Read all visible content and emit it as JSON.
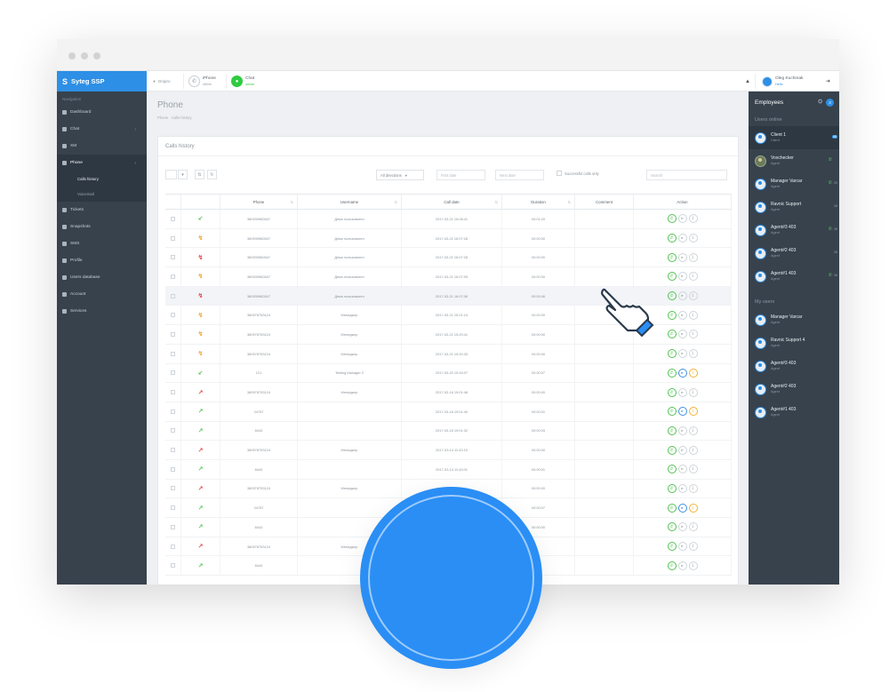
{
  "app": {
    "brand_icon": "S",
    "brand_name": "Syteg SSP"
  },
  "sidebar": {
    "section_label": "Navigation",
    "items": [
      {
        "label": "Dashboard",
        "icon": "dashboard-icon",
        "expandable": false,
        "active": false
      },
      {
        "label": "Chat",
        "icon": "chat-icon",
        "expandable": true,
        "active": false
      },
      {
        "label": "XM",
        "icon": "xm-icon",
        "expandable": false,
        "active": false
      },
      {
        "label": "Phone",
        "icon": "phone-icon",
        "expandable": true,
        "active": true
      },
      {
        "label": "Tickets",
        "icon": "ticket-icon",
        "expandable": false,
        "active": false
      },
      {
        "label": "Snapshots",
        "icon": "snapshot-icon",
        "expandable": false,
        "active": false
      },
      {
        "label": "SMS",
        "icon": "sms-icon",
        "expandable": false,
        "active": false
      },
      {
        "label": "Profile",
        "icon": "profile-icon",
        "expandable": false,
        "active": false
      },
      {
        "label": "Users database",
        "icon": "database-icon",
        "expandable": false,
        "active": false
      },
      {
        "label": "Account",
        "icon": "account-icon",
        "expandable": false,
        "active": false
      },
      {
        "label": "Services",
        "icon": "services-icon",
        "expandable": false,
        "active": false
      }
    ],
    "phone_subitems": [
      {
        "label": "Calls history",
        "active": true
      },
      {
        "label": "Voicemail",
        "active": false
      }
    ]
  },
  "topbar": {
    "location_label": "Dnipro",
    "phone_label": "iPhone",
    "phone_status": "offline",
    "chat_label": "Chat",
    "chat_status": "online",
    "user_name": "Oleg Kuchmak",
    "user_status": "Hello",
    "bell_icon": "bell-icon",
    "logout_icon": "logout-icon"
  },
  "page": {
    "title": "Phone",
    "breadcrumb": "Phone · Calls history",
    "card_title": "Calls history"
  },
  "toolbar": {
    "direction_select": "All directions",
    "first_date_placeholder": "First date",
    "last_date_placeholder": "Next date",
    "successful_only_label": "Successful calls only",
    "search_placeholder": "Search"
  },
  "table": {
    "columns": [
      "",
      "",
      "Phone",
      "Username",
      "Call date",
      "Duration",
      "Comment",
      "Action"
    ],
    "rows": [
      {
        "type": "in",
        "phone": "380939982847",
        "username": "Демо пользовател",
        "date": "2017-03-21 16:08:41",
        "duration": "00:01:20",
        "actions": "call"
      },
      {
        "type": "missed-in",
        "phone": "380939982847",
        "username": "Демо пользовател",
        "date": "2017-03-21 16:07:28",
        "duration": "00:00:00",
        "actions": "call"
      },
      {
        "type": "rejected",
        "phone": "380939982847",
        "username": "Демо пользовател",
        "date": "2017-03-21 16:07:28",
        "duration": "00:00:00",
        "actions": "call"
      },
      {
        "type": "missed-in",
        "phone": "380939982847",
        "username": "Демо пользовател",
        "date": "2017-03-21 16:07:09",
        "duration": "00:00:00",
        "actions": "call"
      },
      {
        "type": "rejected",
        "phone": "380939982847",
        "username": "Демо пользовател",
        "date": "2017-03-21 16:07:06",
        "duration": "00:00:06",
        "actions": "call",
        "highlight": true
      },
      {
        "type": "missed-in",
        "phone": "380978753124",
        "username": "Менеджер",
        "date": "2017-03-21 15:21:14",
        "duration": "00:00:00",
        "actions": "call"
      },
      {
        "type": "missed-in",
        "phone": "380978753124",
        "username": "Менеджер",
        "date": "2017-03-21 15:20:41",
        "duration": "00:00:00",
        "actions": "call"
      },
      {
        "type": "missed-in",
        "phone": "380978753124",
        "username": "Менеджер",
        "date": "2017-03-21 15:20:33",
        "duration": "00:00:00",
        "actions": "call"
      },
      {
        "type": "in",
        "phone": "121",
        "username": "Testing Manager 2",
        "date": "2017-03-20 15:16:07",
        "duration": "00:00:07",
        "actions": "full"
      },
      {
        "type": "missed-out",
        "phone": "380978753124",
        "username": "Менеджер",
        "date": "2017-03-18 19:01:48",
        "duration": "00:00:00",
        "actions": "call"
      },
      {
        "type": "out",
        "phone": "24787",
        "username": "",
        "date": "2017-03-18 19:01:40",
        "duration": "00:00:01",
        "actions": "full"
      },
      {
        "type": "out",
        "phone": "8443",
        "username": "",
        "date": "2017-03-18 19:01:32",
        "duration": "00:00:03",
        "actions": "call"
      },
      {
        "type": "missed-out",
        "phone": "380978753124",
        "username": "Менеджер",
        "date": "2017-03-14 11:43:19",
        "duration": "00:00:00",
        "actions": "call"
      },
      {
        "type": "out",
        "phone": "8443",
        "username": "",
        "date": "2017-03-14 11:43:01",
        "duration": "00:00:01",
        "actions": "call"
      },
      {
        "type": "missed-out",
        "phone": "380978753124",
        "username": "Менеджер",
        "date": "",
        "duration": "00:00:00",
        "actions": "call"
      },
      {
        "type": "out",
        "phone": "24787",
        "username": "",
        "date": "",
        "duration": "00:00:07",
        "actions": "full"
      },
      {
        "type": "out",
        "phone": "8443",
        "username": "",
        "date": "",
        "duration": "00:00:00",
        "actions": "call"
      },
      {
        "type": "missed-out",
        "phone": "380978753124",
        "username": "Менеджер",
        "date": "",
        "duration": "",
        "actions": "call"
      },
      {
        "type": "out",
        "phone": "8443",
        "username": "",
        "date": "",
        "duration": "",
        "actions": "call"
      }
    ]
  },
  "employees": {
    "title": "Employees",
    "badge": "3",
    "online_label": "Users online",
    "online": [
      {
        "name": "Client 1",
        "role": "Client",
        "count": "88",
        "phone": false,
        "selected": true
      },
      {
        "name": "Voxchecker",
        "role": "Agent",
        "count": "",
        "phone": true,
        "photo": true
      },
      {
        "name": "Manager Varcar",
        "role": "Agent",
        "count": "39",
        "phone": true
      },
      {
        "name": "Ravnic Support",
        "role": "Agent",
        "count": "38",
        "phone": false
      },
      {
        "name": "Agent#3 403",
        "role": "Agent",
        "count": "38",
        "phone": true
      },
      {
        "name": "Agent#2 403",
        "role": "Agent",
        "count": "38",
        "phone": false
      },
      {
        "name": "Agent#1 403",
        "role": "Agent",
        "count": "38",
        "phone": true
      }
    ],
    "my_label": "My users",
    "my": [
      {
        "name": "Manager Varcar",
        "role": "Agent"
      },
      {
        "name": "Ravnic Support 4",
        "role": "Agent"
      },
      {
        "name": "Agent#3 403",
        "role": "Agent"
      },
      {
        "name": "Agent#2 403",
        "role": "Agent"
      },
      {
        "name": "Agent#1 403",
        "role": "Agent"
      }
    ]
  },
  "icons": {
    "call_in": "↙",
    "call_out": "↗",
    "call_missed_in": "↯",
    "call_rejected": "↯"
  },
  "colors": {
    "accent": "#2d8fe5",
    "sidebar_bg": "#37424d",
    "call_in": "#4fc34f",
    "call_missed": "#f0a030",
    "call_rejected": "#e23c3c",
    "online": "#2ecc40"
  }
}
